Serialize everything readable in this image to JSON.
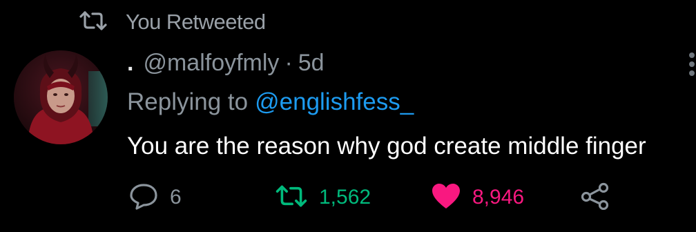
{
  "retweet_bar": {
    "label": "You Retweeted",
    "icon": "retweet-icon"
  },
  "tweet": {
    "display_name": ".",
    "handle": "@malfoyfmly",
    "separator": "·",
    "time": "5d",
    "replying_label": "Replying to",
    "replying_to": "@englishfess_",
    "text": "You are the reason why god create middle finger"
  },
  "actions": {
    "reply": {
      "icon": "reply-bubble-icon",
      "count": "6"
    },
    "retweet": {
      "icon": "retweet-icon",
      "count": "1,562",
      "color": "#00ba7c"
    },
    "like": {
      "icon": "heart-icon",
      "count": "8,946",
      "color": "#f91880"
    },
    "share": {
      "icon": "share-icon"
    }
  },
  "colors": {
    "background": "#000000",
    "muted_text": "#8b949c",
    "link": "#1d9bf0",
    "text": "#ffffff"
  }
}
